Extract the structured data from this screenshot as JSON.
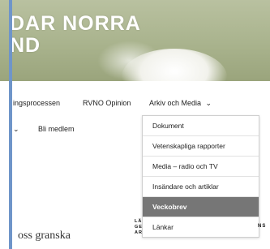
{
  "hero": {
    "title_line1": "DAR NORRA",
    "title_line2": "ND"
  },
  "nav": {
    "row1": [
      {
        "label": "ingsprocessen"
      },
      {
        "label": "RVNO Opinion"
      },
      {
        "label": "Arkiv och Media"
      }
    ],
    "row1_chevron": "⌄",
    "row2_chevron": "⌄",
    "row2": [
      {
        "label": "Bli medlem"
      }
    ]
  },
  "dropdown": {
    "items": [
      {
        "label": "Dokument"
      },
      {
        "label": "Vetenskapliga rapporter"
      },
      {
        "label": "Media – radio och TV"
      },
      {
        "label": "Insändare och artiklar"
      },
      {
        "label": "Veckobrev",
        "active": true
      },
      {
        "label": "Länkar"
      }
    ]
  },
  "content": {
    "heading": "oss granska",
    "logo_line1": "LÄ",
    "logo_line2": "GE",
    "logo_line3": "AR",
    "logo_tail": "NS"
  },
  "colors": {
    "frame": "#6f95c9",
    "active_item_bg": "#767676"
  }
}
